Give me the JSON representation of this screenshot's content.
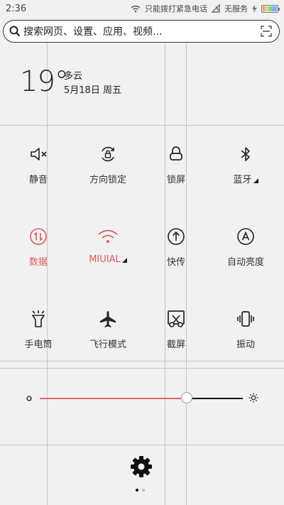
{
  "status_bar": {
    "time": "2:36",
    "emergency_text": "只能拨打紧急电话",
    "service_text": "无服务"
  },
  "search": {
    "placeholder": "搜索网页、设置、应用、视频..."
  },
  "weather": {
    "temp": "19°",
    "condition": "多云",
    "date": "5月18日 周五"
  },
  "tiles": [
    {
      "label": "静音",
      "icon": "mute-icon",
      "active": false
    },
    {
      "label": "方向锁定",
      "icon": "rotation-lock-icon",
      "active": false
    },
    {
      "label": "锁屏",
      "icon": "lock-icon",
      "active": false
    },
    {
      "label": "蓝牙",
      "icon": "bluetooth-icon",
      "active": false
    },
    {
      "label": "数据",
      "icon": "data-icon",
      "active": true
    },
    {
      "label": "MIUIAL",
      "icon": "wifi-icon",
      "active": true
    },
    {
      "label": "快传",
      "icon": "quick-transfer-icon",
      "active": false
    },
    {
      "label": "自动亮度",
      "icon": "auto-brightness-icon",
      "active": false
    },
    {
      "label": "手电筒",
      "icon": "flashlight-icon",
      "active": false
    },
    {
      "label": "飞行模式",
      "icon": "airplane-icon",
      "active": false
    },
    {
      "label": "截屏",
      "icon": "screenshot-icon",
      "active": false
    },
    {
      "label": "振动",
      "icon": "vibrate-icon",
      "active": false
    }
  ],
  "brightness": {
    "level": 0.72
  },
  "colors": {
    "accent": "#e05a5a",
    "text": "#222222",
    "background": "#f1f1f1"
  }
}
